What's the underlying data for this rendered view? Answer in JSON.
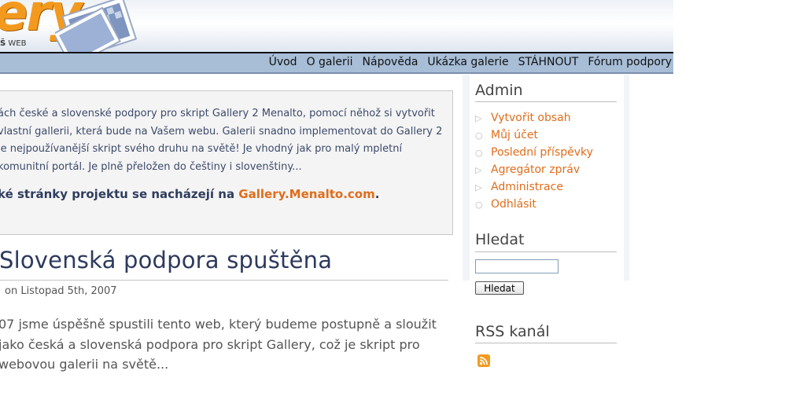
{
  "header": {
    "logo_text": "ery",
    "logo_sub_bold": "Š",
    "logo_sub": "WEB"
  },
  "nav": {
    "items": [
      "Úvod",
      "O galerii",
      "Nápověda",
      "Ukázka galerie",
      "STÁHNOUT",
      "Fórum podpory"
    ]
  },
  "intro": {
    "text": "ách české a slovenské podpory pro skript Gallery 2 Menalto, pomocí něhož si vytvořit vlastní gallerii, která bude na Vašem webu. Galerii snadno implementovat do Gallery 2 je nejpoužívanější skript svého druhu na světě! Je vhodný jak pro malý mpletní komunitní portál. Je plně přeložen do češtiny i slovenštiny...",
    "home_prefix": "ké stránky projektu se nacházejí na ",
    "home_link": "Gallery.Menalto.com",
    "home_suffix": "."
  },
  "post": {
    "title": "Slovenská podpora spuštěna",
    "date": "on Listopad 5th, 2007",
    "body": "07 jsme úspěšně spustili tento web, který budeme postupně a sloužit jako česká a slovenská podpora pro skript Gallery, což je skript pro webovou galerii na světě..."
  },
  "sidebar": {
    "admin_title": "Admin",
    "admin_items": [
      {
        "label": "Vytvořit obsah",
        "icon": "triangle-icon"
      },
      {
        "label": "Můj účet",
        "icon": "circle-icon"
      },
      {
        "label": "Poslední příspěvky",
        "icon": "circle-icon"
      },
      {
        "label": "Agregátor zpráv",
        "icon": "triangle-icon"
      },
      {
        "label": "Administrace",
        "icon": "triangle-icon"
      },
      {
        "label": "Odhlásit",
        "icon": "circle-icon"
      }
    ],
    "search_title": "Hledat",
    "search_value": "",
    "search_button": "Hledat",
    "rss_title": "RSS kanál",
    "rss_icon": "rss-icon"
  },
  "colors": {
    "link": "#e06d1b",
    "heading": "#2d3a5e",
    "nav_bg": "#a8bed7"
  }
}
